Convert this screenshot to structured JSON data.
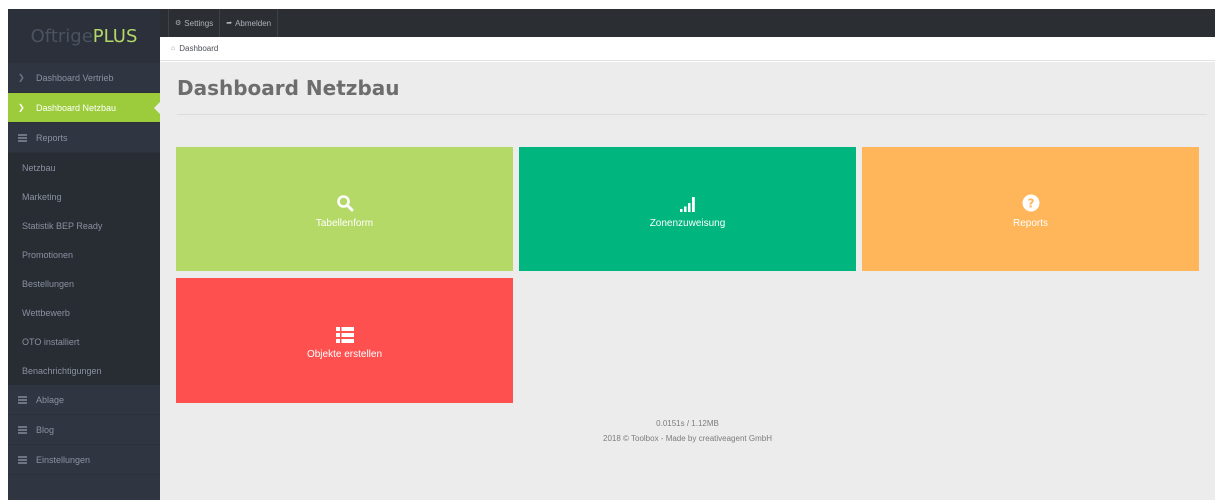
{
  "brand": {
    "part1": "Oftrige",
    "part2": "PLUS"
  },
  "topbar": {
    "settings": {
      "label": "Settings",
      "icon": "gear-icon"
    },
    "logout": {
      "label": "Abmelden",
      "icon": "share-arrow-icon"
    }
  },
  "breadcrumb": {
    "label": "Dashboard",
    "icon": "home-icon"
  },
  "sidebar": {
    "dashboard_vertrieb": "Dashboard Vertrieb",
    "dashboard_netzbau": "Dashboard Netzbau",
    "reports": "Reports",
    "reports_items": [
      "Netzbau",
      "Marketing",
      "Statistik BEP Ready",
      "Promotionen",
      "Bestellungen",
      "Wettbewerb",
      "OTO installiert",
      "Benachrichtigungen"
    ],
    "ablage": "Ablage",
    "blog": "Blog",
    "einstellungen": "Einstellungen"
  },
  "page": {
    "title": "Dashboard Netzbau"
  },
  "tiles": [
    {
      "label": "Tabellenform",
      "icon": "search-icon",
      "color": "#b5d967"
    },
    {
      "label": "Zonenzuweisung",
      "icon": "signal-bars-icon",
      "color": "#00b57e"
    },
    {
      "label": "Reports",
      "icon": "question-circle-icon",
      "color": "#ffb55a"
    },
    {
      "label": "Objekte erstellen",
      "icon": "list-icon",
      "color": "#ff5050"
    }
  ],
  "footer": {
    "stats": "0.0151s / 1.12MB",
    "copyright": "2018 © Toolbox - Made by creativeagent GmbH"
  },
  "colors": {
    "sidebar_bg": "#303641",
    "active_nav": "#9ccc3c",
    "topbar_bg": "#2b2e33",
    "main_bg": "#ececec",
    "brand_accent": "#b3d868"
  }
}
